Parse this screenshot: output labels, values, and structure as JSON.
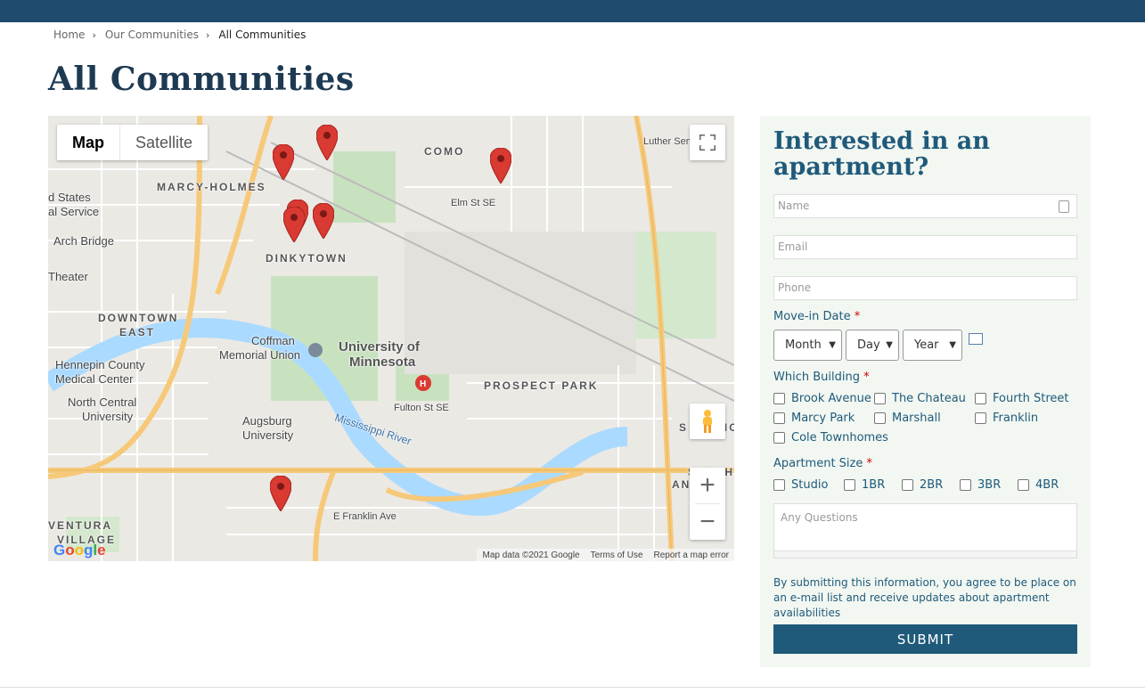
{
  "breadcrumb": {
    "home": "Home",
    "communities": "Our Communities",
    "current": "All Communities"
  },
  "page_title": "All Communities",
  "map": {
    "type_map": "Map",
    "type_satellite": "Satellite",
    "attribution": "Map data ©2021 Google",
    "terms": "Terms of Use",
    "report": "Report a map error",
    "logo": "Google",
    "labels": {
      "como": "COMO",
      "marcy_holmes": "MARCY-HOLMES",
      "dinkytown": "DINKYTOWN",
      "downtown": "DOWNTOWN",
      "east": "EAST",
      "prospect_park": "PROSPECT PARK",
      "university": "University of",
      "minnesota": "Minnesota",
      "luther": "Luther Seminary",
      "hennepin": "Hennepin County",
      "medical": "Medical Center",
      "north_central": "North Central",
      "north_central_uni": "University",
      "coffman": "Coffman",
      "coffman2": "Memorial Union",
      "augsburg": "Augsburg",
      "augsburg2": "University",
      "arch_bridge": "Arch Bridge",
      "theater": "Theater",
      "states": "d States",
      "service": "al Service",
      "mississippi": "Mississippi River",
      "franklin": "E Franklin Ave",
      "fulton": "Fulton St SE",
      "elm": "Elm St SE",
      "ventura": "VENTURA",
      "village": "VILLAGE",
      "st_anthony": "S ANTHONY P",
      "souths": "SOUTHS",
      "anthony2": "ANTHO"
    },
    "marker_color": "#d93a32"
  },
  "form": {
    "title": "Interested in an apartment?",
    "name_placeholder": "Name",
    "email_placeholder": "Email",
    "phone_placeholder": "Phone",
    "movein_label": "Move-in Date",
    "required_mark": "*",
    "month": "Month",
    "day": "Day",
    "year": "Year",
    "building_label": "Which Building",
    "buildings": [
      "Brook Avenue",
      "The Chateau",
      "Fourth Street",
      "Marcy Park",
      "Marshall",
      "Franklin",
      "Cole Townhomes"
    ],
    "size_label": "Apartment Size",
    "sizes": [
      "Studio",
      "1BR",
      "2BR",
      "3BR",
      "4BR"
    ],
    "questions_placeholder": "Any Questions",
    "disclaimer": "By submitting this information, you agree to be place on an e-mail list and receive updates about apartment availabilities",
    "submit": "SUBMIT"
  }
}
